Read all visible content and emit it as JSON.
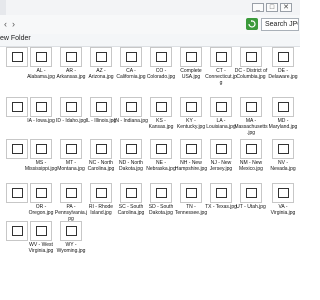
{
  "window": {
    "minimize": "_",
    "maximize": "□",
    "close": "✕"
  },
  "address": {
    "back": "‹",
    "forward": "›",
    "search_placeholder": "Search JPG"
  },
  "toolbar": {
    "new_folder": "ew Folder"
  },
  "files": [
    {
      "label": ""
    },
    {
      "label": "AL - Alabama.jpg"
    },
    {
      "label": "AR - Arkansas.jpg"
    },
    {
      "label": "AZ - Arizona.jpg"
    },
    {
      "label": "CA - California.jpg"
    },
    {
      "label": "CO - Colorado.jpg"
    },
    {
      "label": "Complete USA.jpg"
    },
    {
      "label": "CT - Connecticut.jpg"
    },
    {
      "label": "DC - District of Columbia.jpg"
    },
    {
      "label": "DE - Delaware.jpg"
    },
    {
      "label": ""
    },
    {
      "label": "IA - Iowa.jpg"
    },
    {
      "label": "ID - Idaho.jpg"
    },
    {
      "label": "IL - Illinois.jpg"
    },
    {
      "label": "IN - Indiana.jpg"
    },
    {
      "label": "KS - Kansas.jpg"
    },
    {
      "label": "KY - Kentucky.jpg"
    },
    {
      "label": "LA - Louisiana.jpg"
    },
    {
      "label": "MA - Massachusetts.jpg"
    },
    {
      "label": "MD - Maryland.jpg"
    },
    {
      "label": ""
    },
    {
      "label": "MS - Mississippi.jpg"
    },
    {
      "label": "MT - Montana.jpg"
    },
    {
      "label": "NC - North Carolina.jpg"
    },
    {
      "label": "ND - North Dakota.jpg"
    },
    {
      "label": "NE - Nebraska.jpg"
    },
    {
      "label": "NH - New Hampshire.jpg"
    },
    {
      "label": "NJ - New Jersey.jpg"
    },
    {
      "label": "NM - New Mexico.jpg"
    },
    {
      "label": "NV - Nevada.jpg"
    },
    {
      "label": ""
    },
    {
      "label": "OR - Oregon.jpg"
    },
    {
      "label": "PA - Pennsylvania.jpg"
    },
    {
      "label": "RI - Rhode Island.jpg"
    },
    {
      "label": "SC - South Carolina.jpg"
    },
    {
      "label": "SD - South Dakota.jpg"
    },
    {
      "label": "TN - Tennessee.jpg"
    },
    {
      "label": "TX - Texas.jpg"
    },
    {
      "label": "UT - Utah.jpg"
    },
    {
      "label": "VA - Virginia.jpg"
    },
    {
      "label": ""
    },
    {
      "label": "WV - West Virginia.jpg"
    },
    {
      "label": "WY - Wyoming.jpg"
    }
  ]
}
